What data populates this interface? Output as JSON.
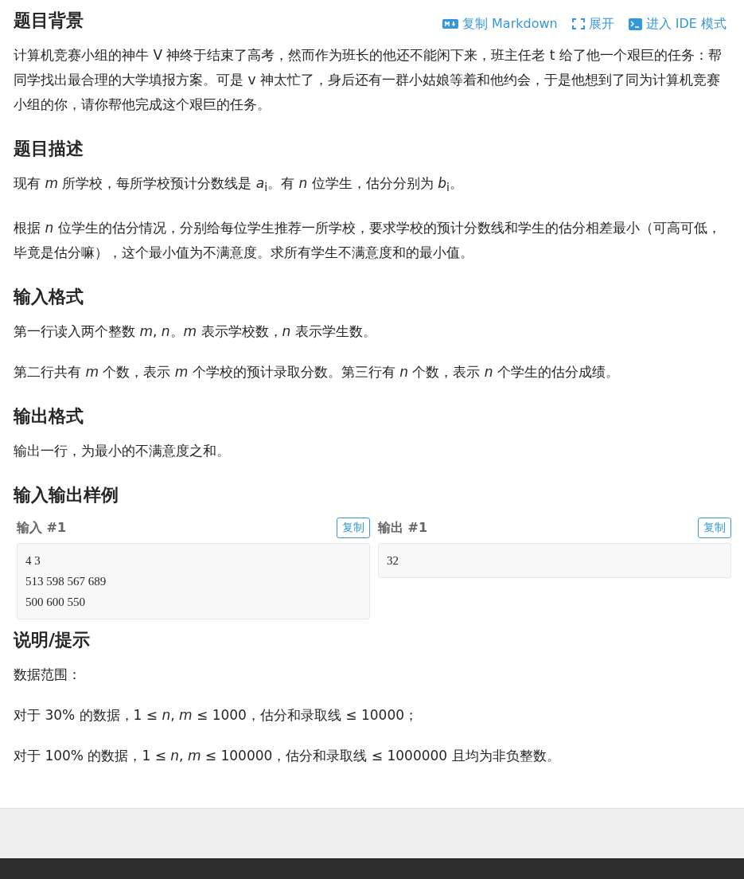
{
  "actions": [
    {
      "kind": "markdown",
      "label": "复制 Markdown"
    },
    {
      "kind": "expand",
      "label": "展开"
    },
    {
      "kind": "ide",
      "label": "进入 IDE 模式"
    }
  ],
  "sections": [
    {
      "title": "题目背景",
      "paragraphs": [
        "计算机竞赛小组的神牛 V 神终于结束了高考，然而作为班长的他还不能闲下来，班主任老 t 给了他一个艰巨的任务：帮同学找出最合理的大学填报方案。可是 v 神太忙了，身后还有一群小姑娘等着和他约会，于是他想到了同为计算机竞赛小组的你，请你帮他完成这个艰巨的任务。"
      ]
    },
    {
      "title": "题目描述",
      "paragraphs": [
        "现有 *m* 所学校，每所学校预计分数线是 *a*$_{i}$。有 *n* 位学生，估分分别为 *b*$_{i}$。",
        "根据 *n* 位学生的估分情况，分别给每位学生推荐一所学校，要求学校的预计分数线和学生的估分相差最小（可高可低，毕竟是估分嘛），这个最小值为不满意度。求所有学生不满意度和的最小值。"
      ]
    },
    {
      "title": "输入格式",
      "paragraphs": [
        "第一行读入两个整数 *m*, *n*。*m* 表示学校数，*n* 表示学生数。",
        "第二行共有 *m* 个数，表示 *m* 个学校的预计录取分数。第三行有 *n* 个数，表示 *n* 个学生的估分成绩。"
      ]
    },
    {
      "title": "输出格式",
      "paragraphs": [
        "输出一行，为最小的不满意度之和。"
      ]
    },
    {
      "title": "输入输出样例",
      "samples": [
        {
          "label": "输入 #1",
          "copy": "复制",
          "lines": [
            "4 3",
            "513 598 567 689",
            "500 600 550"
          ]
        },
        {
          "label": "输出 #1",
          "copy": "复制",
          "lines": [
            "32"
          ]
        }
      ]
    },
    {
      "title": "说明/提示",
      "paragraphs": [
        "数据范围：",
        "对于 30% 的数据，1 ≤ *n*, *m* ≤ 1000，估分和录取线 ≤ 10000；",
        "对于 100% 的数据，1 ≤ *n*, *m* ≤ 100000，估分和录取线 ≤ 1000000 且均为非负整数。"
      ]
    }
  ]
}
